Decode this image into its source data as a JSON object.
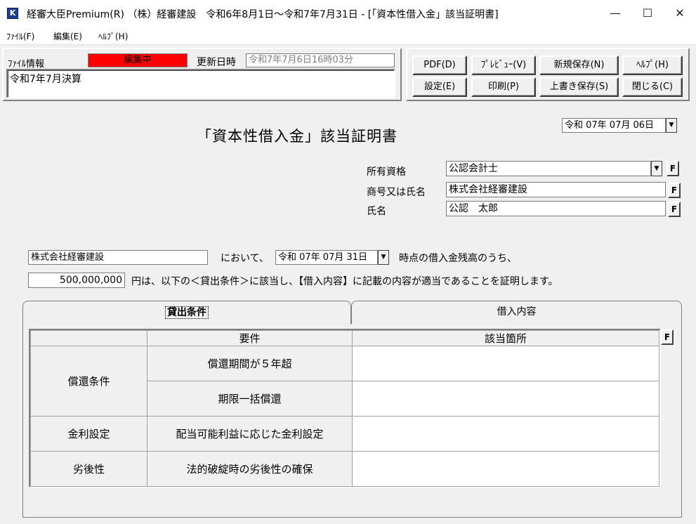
{
  "window": {
    "title": "経審大臣Premium(R) （株）経審建設　令和6年8月1日～令和7年7月31日 - [「資本性借入金」該当証明書]",
    "icon_letter": "K",
    "minimize": "—",
    "maximize": "☐",
    "close": "✕"
  },
  "menu": [
    "ﾌｧｲﾙ(F)",
    "編集(E)",
    "ﾍﾙﾌﾟ(H)"
  ],
  "file_info": {
    "label": "ﾌｧｲﾙ情報",
    "status": "編集中",
    "status_color": "#ff0000",
    "updated_label": "更新日時",
    "updated_value": "令和7年7月6日16時03分",
    "memo": "令和7年7月決算"
  },
  "toolbar": {
    "pdf": "PDF(D)",
    "preview": "ﾌﾟﾚﾋﾞｭｰ(V)",
    "save_new": "新規保存(N)",
    "help": "ﾍﾙﾌﾟ(H)",
    "settings": "設定(E)",
    "print": "印刷(P)",
    "overwrite": "上書き保存(S)",
    "close": "閉じる(C)"
  },
  "document": {
    "title": "「資本性借入金」該当証明書",
    "date": "令和 07年 07月 06日",
    "qualification_label": "所有資格",
    "qualification_value": "公認会計士",
    "company_label": "商号又は氏名",
    "company_value": "株式会社経審建設",
    "name_label": "氏名",
    "name_value": "公認　太郎",
    "f_label": "F"
  },
  "statement": {
    "company": "株式会社経審建設",
    "text1": "において、",
    "date": "令和 07年 07月 31日",
    "text2": "時点の借入金残高のうち、",
    "amount": "500,000,000",
    "text3": "円は、以下の＜貸出条件＞に該当し、【借入内容】に記載の内容が適当であることを証明します。"
  },
  "tabs": {
    "conditions": "貸出条件",
    "loan": "借入内容"
  },
  "grid": {
    "col_requirement": "要件",
    "col_location": "該当箇所",
    "groups": [
      {
        "name": "償還条件",
        "items": [
          "償還期間が５年超",
          "期限一括償還"
        ]
      },
      {
        "name": "金利設定",
        "items": [
          "配当可能利益に応じた金利設定"
        ]
      },
      {
        "name": "劣後性",
        "items": [
          "法的破綻時の劣後性の確保"
        ]
      }
    ]
  }
}
